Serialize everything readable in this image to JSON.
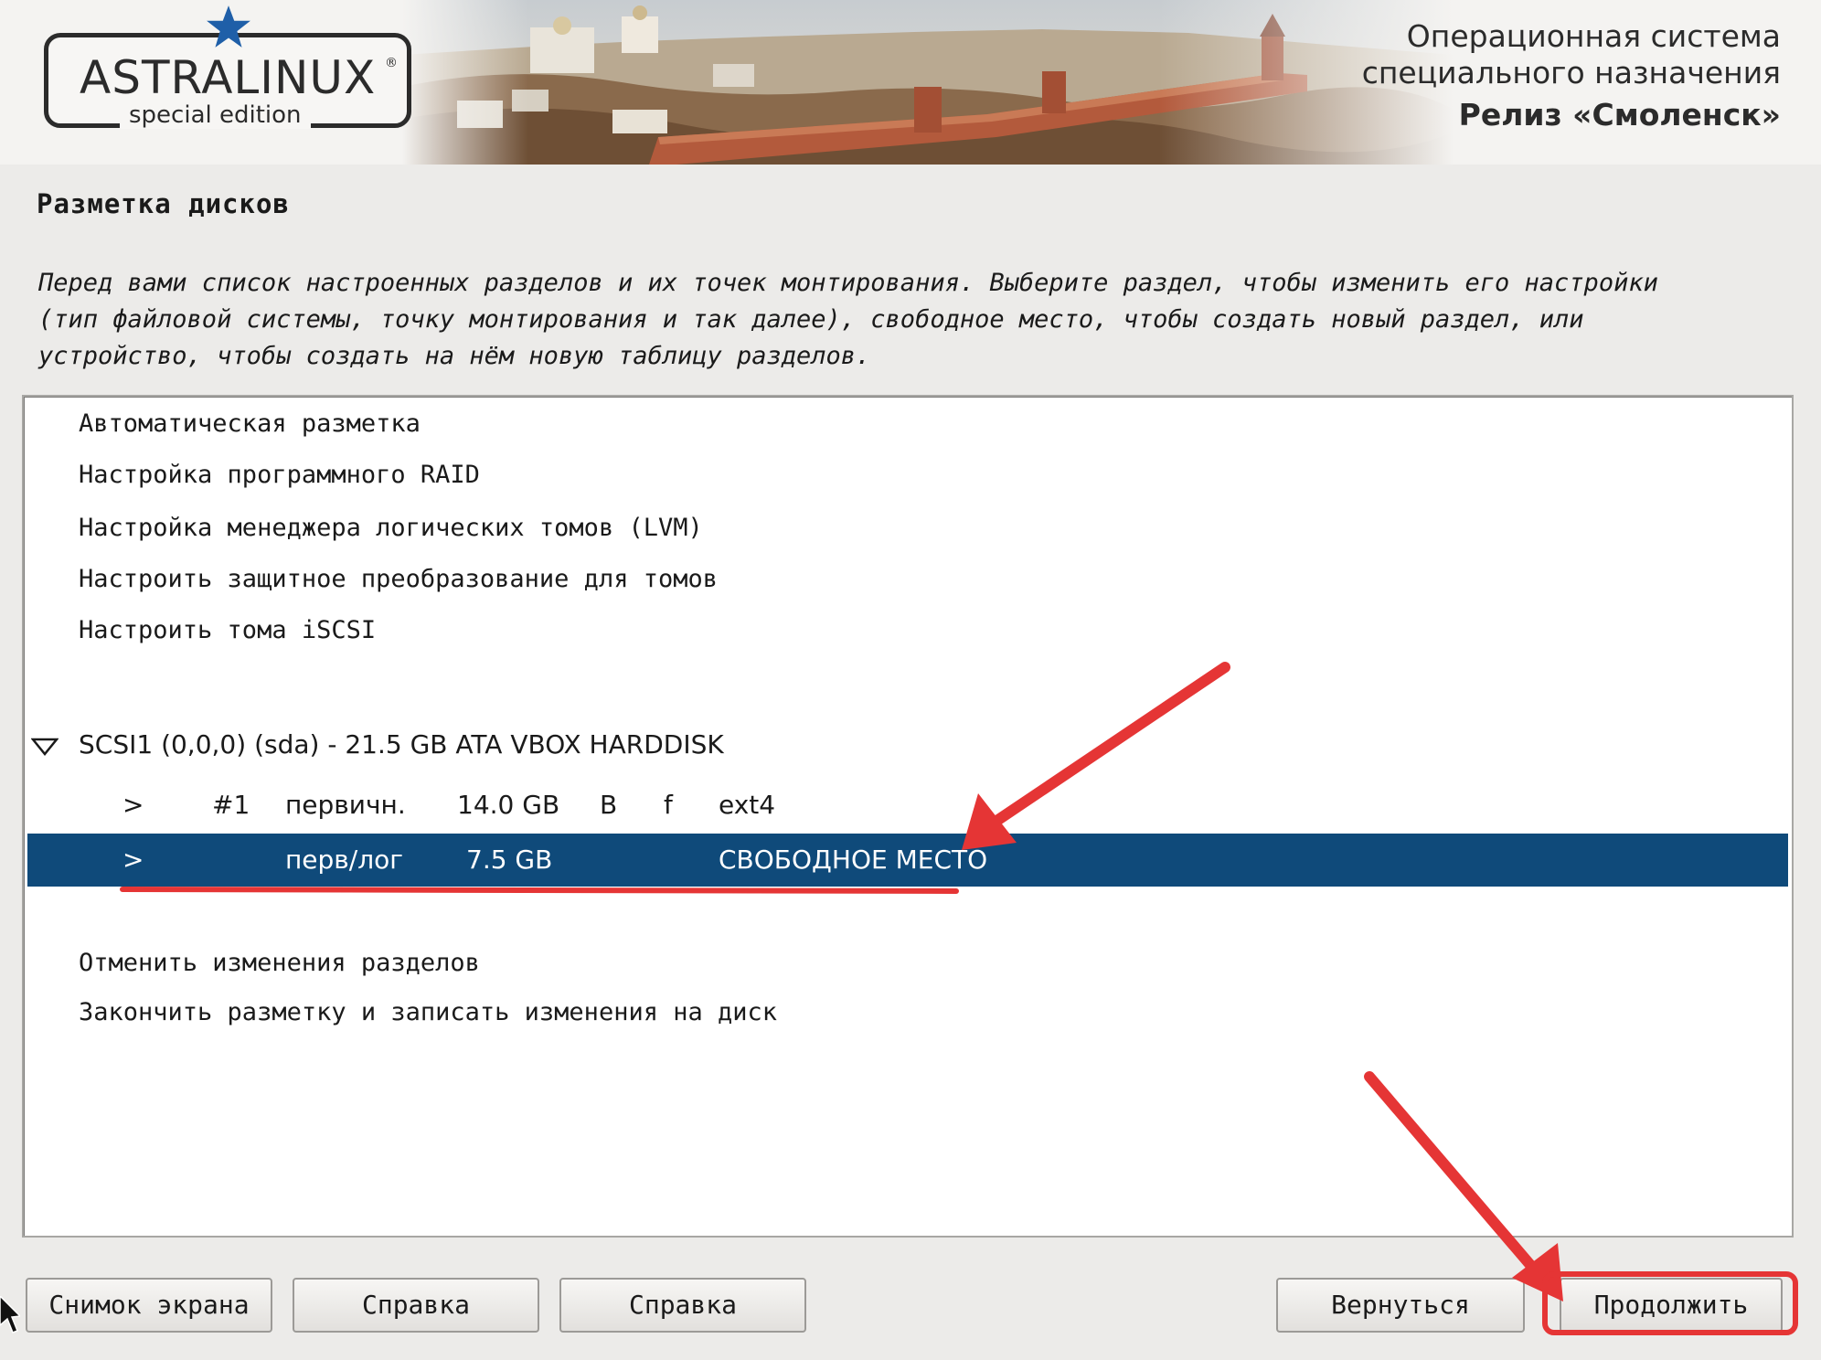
{
  "banner": {
    "logo_main": "ASTRALINUX",
    "logo_reg": "®",
    "logo_sub": "special edition",
    "release_line1": "Операционная система",
    "release_line2": "специального назначения",
    "release_line3": "Релиз «Смоленск»"
  },
  "page": {
    "title": "Разметка дисков",
    "description_lines": [
      "Перед вами список настроенных разделов и их точек монтирования. Выберите раздел, чтобы изменить его настройки",
      "(тип файловой системы, точку монтирования и так далее), свободное место, чтобы создать новый раздел, или",
      "устройство, чтобы создать на нём новую таблицу разделов."
    ]
  },
  "list": {
    "actions_top": [
      "Автоматическая разметка",
      "Настройка программного RAID",
      "Настройка менеджера логических томов (LVM)",
      "Настроить защитное преобразование для томов",
      "Настроить тома iSCSI"
    ],
    "device": {
      "label": "SCSI1 (0,0,0) (sda) - 21.5 GB ATA VBOX HARDDISK",
      "partitions": [
        {
          "arrow": ">",
          "num": "#1",
          "type": "первичн.",
          "size": "14.0 GB",
          "flag1": "B",
          "flag2": "f",
          "fs": "ext4",
          "selected": false
        },
        {
          "arrow": ">",
          "num": "",
          "type": "перв/лог",
          "size": "7.5 GB",
          "flag1": "",
          "flag2": "",
          "fs": "СВОБОДНОЕ МЕСТО",
          "selected": true
        }
      ]
    },
    "actions_bottom": [
      "Отменить изменения разделов",
      "Закончить разметку и записать изменения на диск"
    ]
  },
  "buttons": {
    "screenshot": "Снимок экрана",
    "help1": "Справка",
    "help2": "Справка",
    "back": "Вернуться",
    "continue": "Продолжить"
  },
  "colors": {
    "selection": "#0f4a7a",
    "annotation": "#e53535",
    "background": "#ecebe9"
  },
  "icons": {
    "logo_star": "star-icon",
    "expand": "triangle-down-icon",
    "cursor": "mouse-pointer-icon"
  }
}
